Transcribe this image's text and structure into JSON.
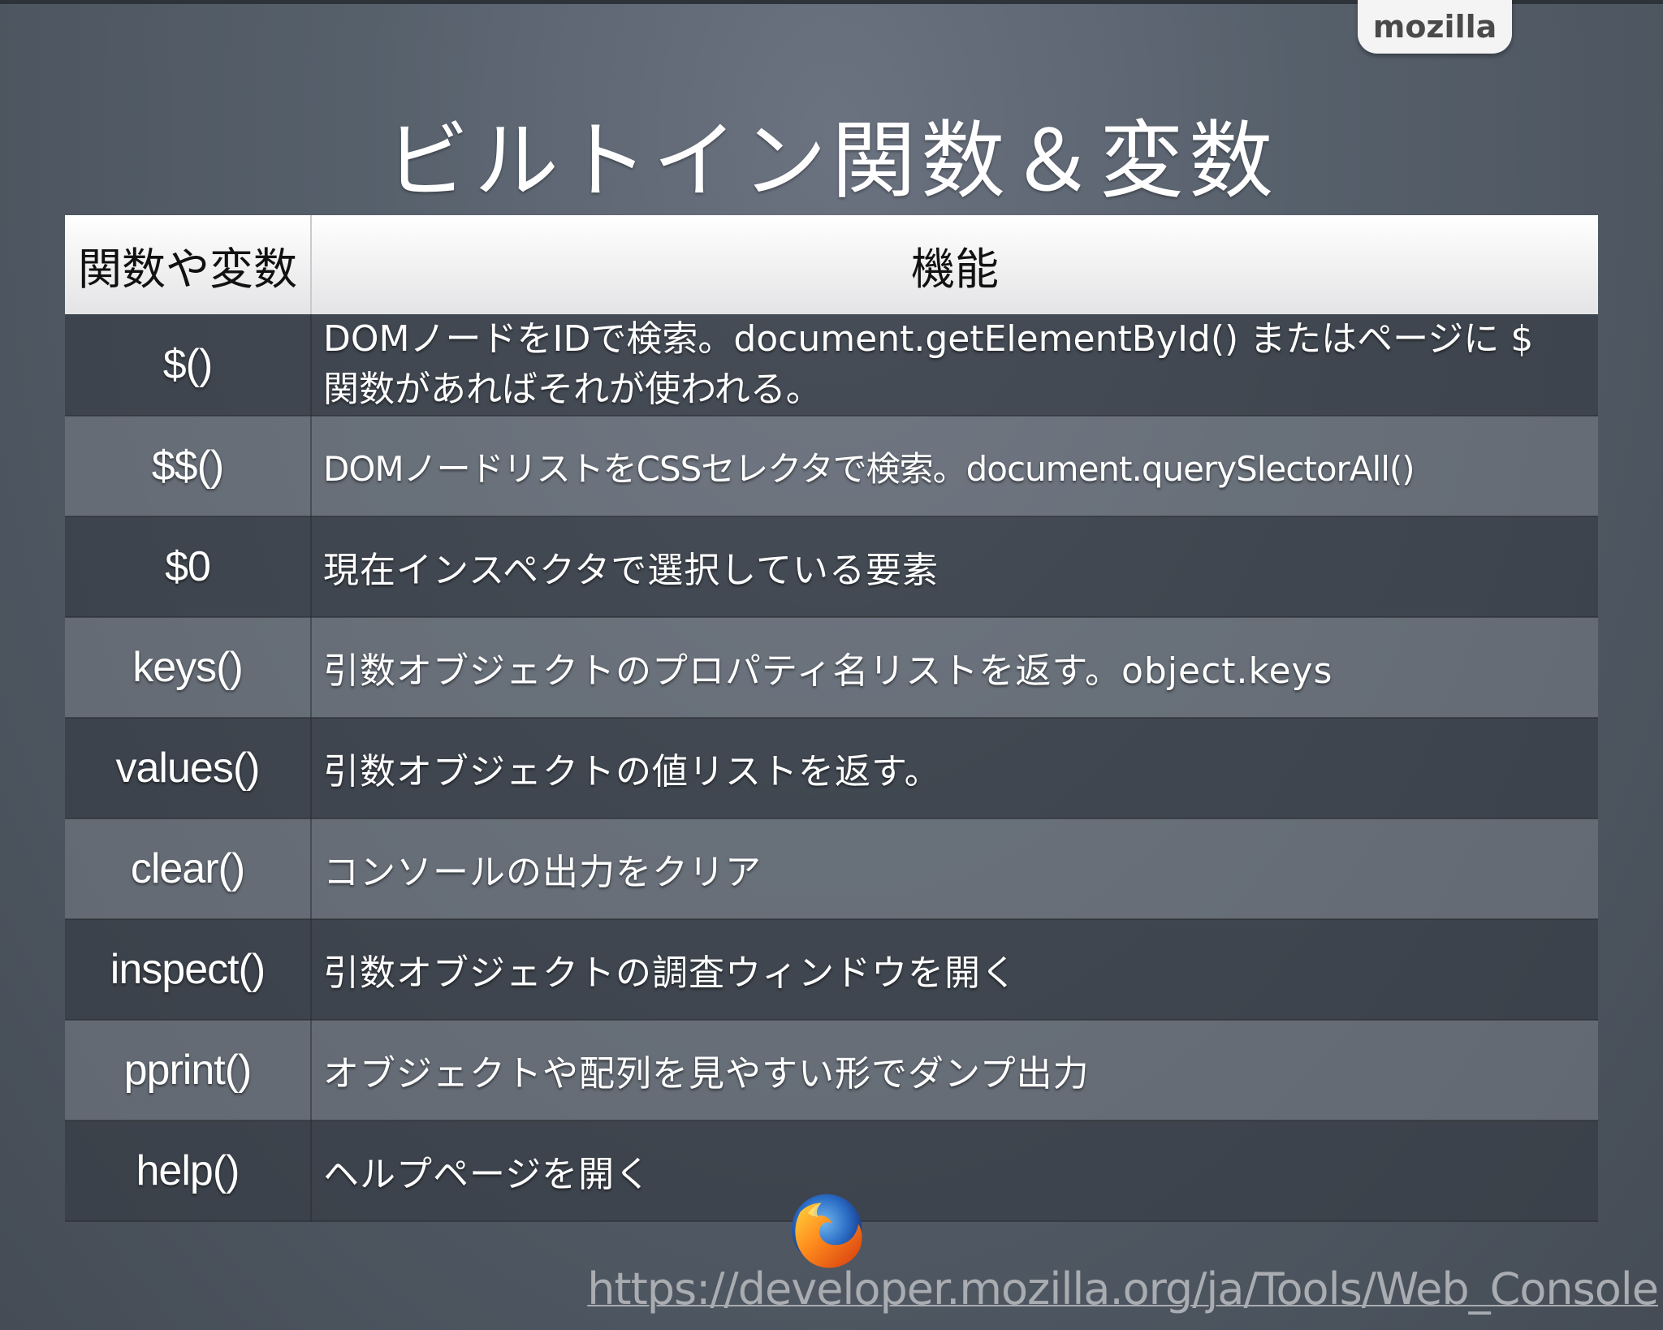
{
  "brand": {
    "label": "mozilla"
  },
  "title": "ビルトイン関数＆変数",
  "table": {
    "headers": [
      "関数や変数",
      "機能"
    ],
    "rows": [
      {
        "name": "$()",
        "description": "DOMノードをIDで検索。document.getElementById() またはページに $ 関数があればそれが使われる。"
      },
      {
        "name": "$$()",
        "description": "DOMノードリストをCSSセレクタで検索。document.querySlectorAll()"
      },
      {
        "name": "$0",
        "description": "現在インスペクタで選択している要素"
      },
      {
        "name": "keys()",
        "description": "引数オブジェクトのプロパティ名リストを返す。object.keys"
      },
      {
        "name": "values()",
        "description": "引数オブジェクトの値リストを返す。"
      },
      {
        "name": "clear()",
        "description": "コンソールの出力をクリア"
      },
      {
        "name": "inspect()",
        "description": "引数オブジェクトの調査ウィンドウを開く"
      },
      {
        "name": "pprint()",
        "description": "オブジェクトや配列を見やすい形でダンプ出力"
      },
      {
        "name": "help()",
        "description": "ヘルプページを開く"
      }
    ]
  },
  "footer": {
    "logo_icon": "firefox-icon",
    "link": "https://developer.mozilla.org/ja/Tools/Web_Console"
  },
  "colors": {
    "background": "#56606b",
    "header_row": "#ececee",
    "row_dark": "#3f454d",
    "row_light": "#6b717a",
    "link": "#a9acb1"
  }
}
